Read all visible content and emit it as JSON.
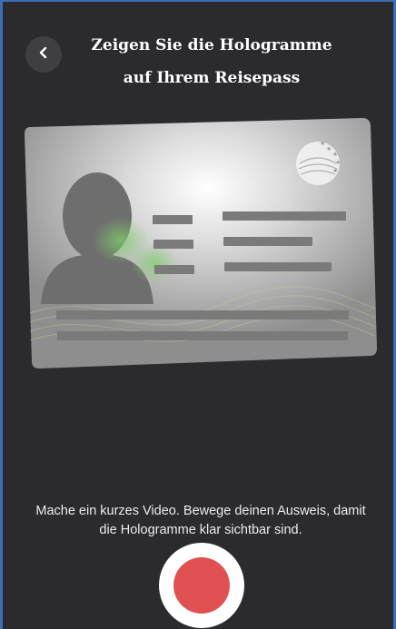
{
  "header": {
    "back_icon": "chevron-left-icon",
    "title": "Zeigen Sie die Hologramme auf Ihrem Reisepass"
  },
  "illustration": {
    "card_icon": "id-card-illustration",
    "emblem_icon": "globe-stars-emblem-icon"
  },
  "instruction": {
    "text": "Mache ein kurzes Video. Bewege deinen Ausweis, damit die Hologramme klar sichtbar sind."
  },
  "record": {
    "icon": "record-button-icon"
  },
  "colors": {
    "background": "#2b2b2d",
    "record_red": "#e05151",
    "frame_blue": "#3b6fb6"
  }
}
